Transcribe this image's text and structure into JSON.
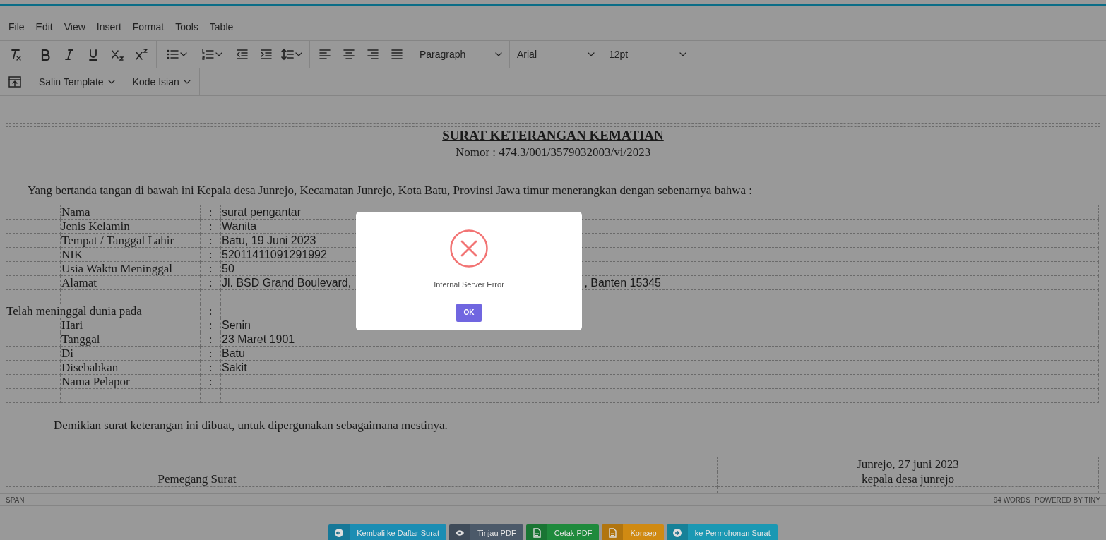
{
  "menubar": [
    "File",
    "Edit",
    "View",
    "Insert",
    "Format",
    "Tools",
    "Table"
  ],
  "toolbar": {
    "block_format": "Paragraph",
    "font": "Arial",
    "size": "12pt"
  },
  "toolbar2": [
    "Salin Template",
    "Kode Isian"
  ],
  "document": {
    "title": "SURAT KETERANGAN KEMATIAN",
    "number": "Nomor : 474.3/001/3579032003/vi/2023",
    "intro": "Yang bertanda tangan di bawah ini Kepala desa Junrejo, Kecamatan Junrejo, Kota Batu, Provinsi Jawa timur menerangkan dengan sebenarnya bahwa :",
    "fields": [
      {
        "label": "Nama",
        "value": "surat pengantar"
      },
      {
        "label": "Jenis Kelamin",
        "value": "Wanita"
      },
      {
        "label": "Tempat / Tanggal Lahir",
        "value": "Batu, 19 Juni 2023"
      },
      {
        "label": "NIK",
        "value": "52011411091291992"
      },
      {
        "label": "Usia Waktu Meninggal",
        "value": "50"
      },
      {
        "label": "Alamat",
        "value": "Jl. BSD Grand Boulevard,",
        "value_end": ", Banten 15345"
      }
    ],
    "death_heading": "Telah meninggal dunia pada",
    "death_fields": [
      {
        "label": "Hari",
        "value": "Senin"
      },
      {
        "label": "Tanggal",
        "value": "23 Maret 1901"
      },
      {
        "label": "Di",
        "value": "Batu"
      },
      {
        "label": "Disebabkan",
        "value": "Sakit"
      },
      {
        "label": "Nama Pelapor"
      }
    ],
    "colon": ":",
    "closing": "Demikian surat keterangan ini dibuat, untuk dipergunakan sebagaimana mestinya.",
    "signature": {
      "date": "Junrejo, 27 juni 2023",
      "left": "Pemegang Surat",
      "right": "kepala desa junrejo"
    }
  },
  "status_bar": {
    "path": "SPAN",
    "words": "94 WORDS",
    "powered": "POWERED BY TINY"
  },
  "actions": [
    {
      "label": "Kembali ke Daftar Surat",
      "kind": "back",
      "color": "#1b8db3"
    },
    {
      "label": "Tinjau PDF",
      "kind": "preview",
      "color": "#4b5969"
    },
    {
      "label": "Cetak PDF",
      "kind": "print",
      "color": "#1e8a3c"
    },
    {
      "label": "Konsep",
      "kind": "draft",
      "color": "#d08a12"
    },
    {
      "label": "ke Permohonan Surat",
      "kind": "forward",
      "color": "#1b98b3"
    }
  ],
  "dialog": {
    "kind": "error",
    "message": "Internal Server Error",
    "button": "OK"
  }
}
